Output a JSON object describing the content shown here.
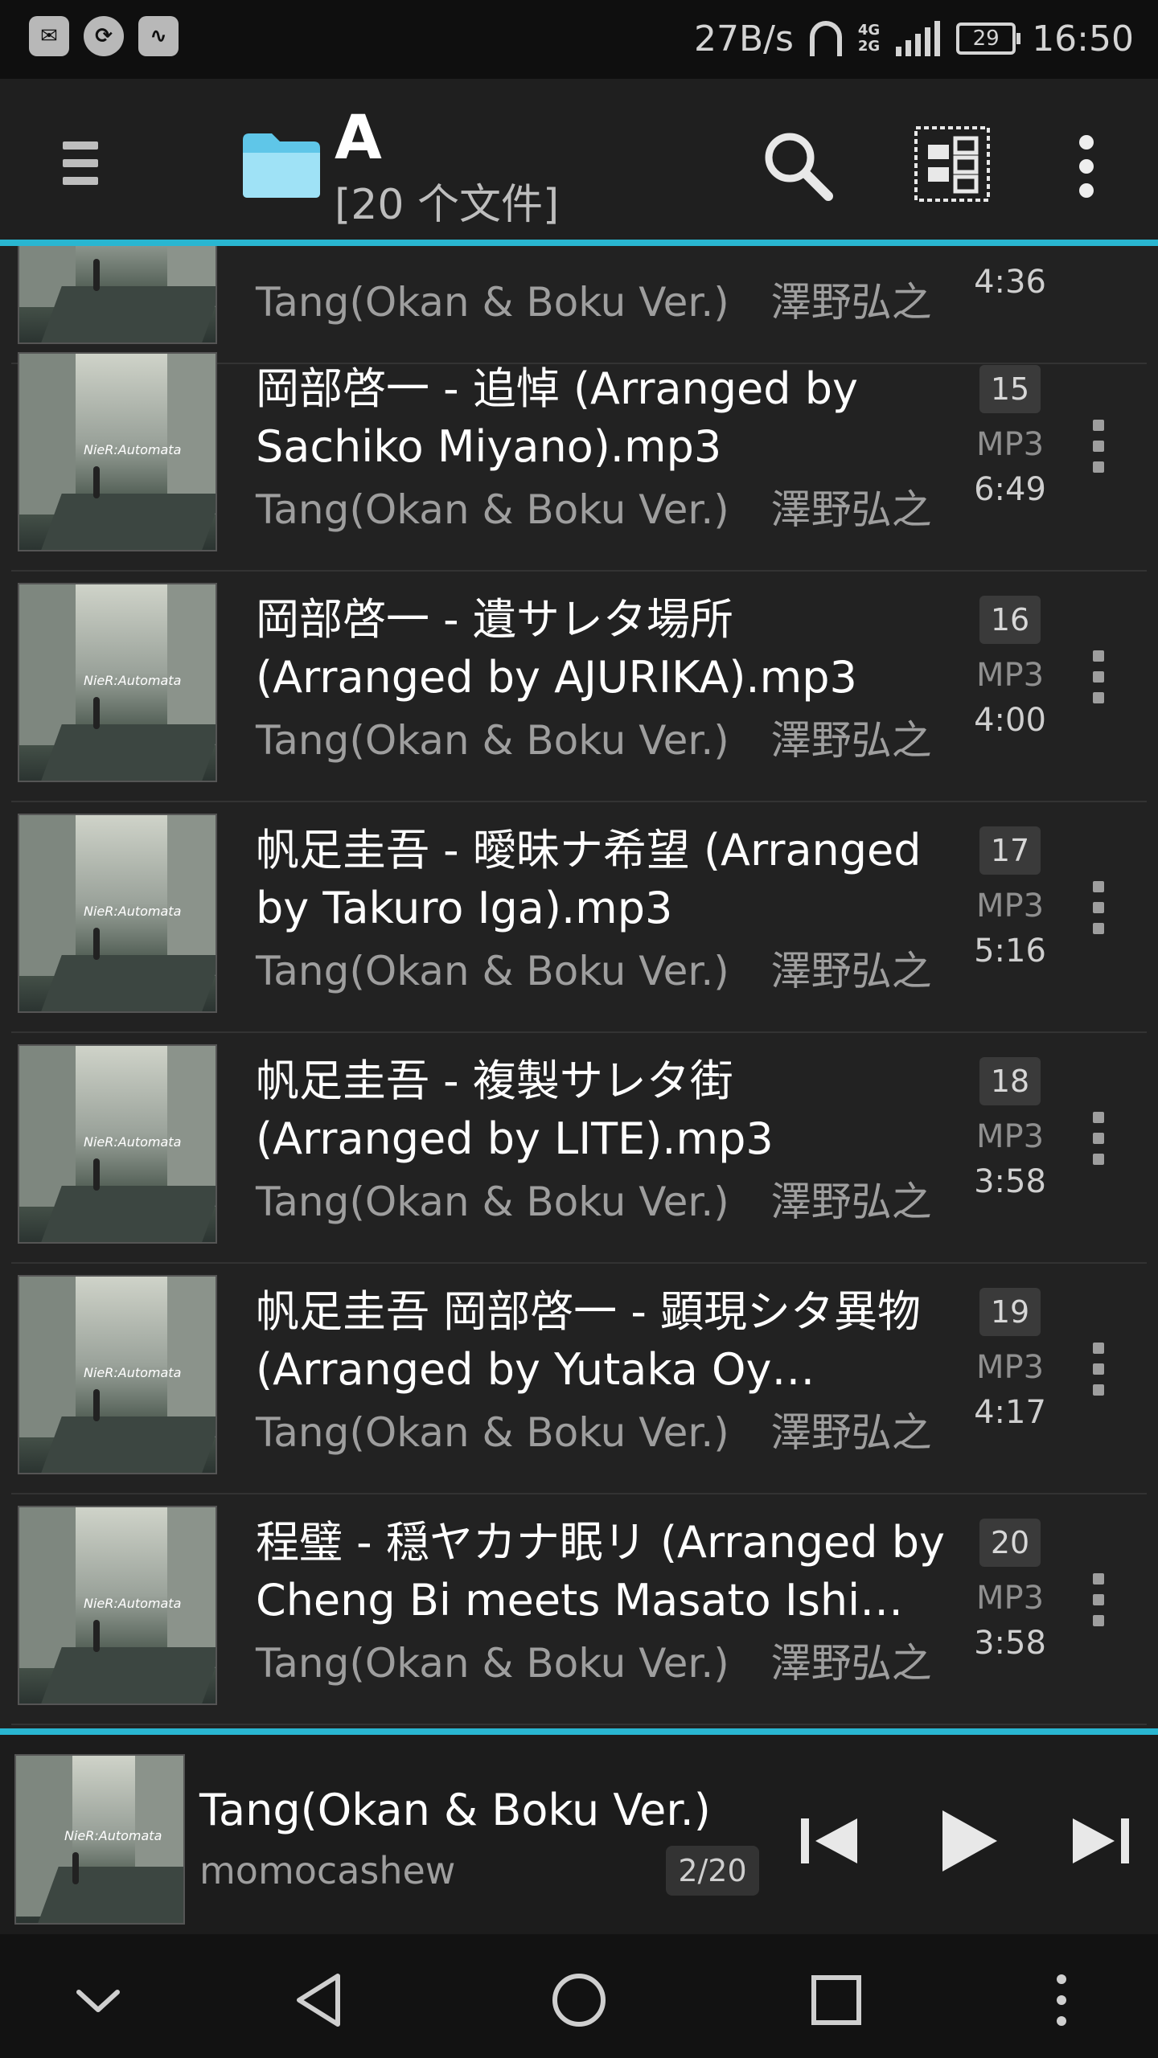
{
  "status_bar": {
    "net_speed": "27B/s",
    "network_type_top": "4G",
    "network_type_bottom": "2G",
    "battery": "29",
    "time": "16:50"
  },
  "toolbar": {
    "title": "A",
    "subtitle": "[20 个文件]",
    "accent_color": "#29b6d1"
  },
  "list": {
    "items": [
      {
        "title": "",
        "album": "Tang(Okan & Boku Ver.)",
        "artist": "澤野弘之",
        "number": "",
        "format": "",
        "duration": "4:36"
      },
      {
        "title": "岡部啓一 - 追悼 (Arranged by Sachiko Miyano).mp3",
        "album": "Tang(Okan & Boku Ver.)",
        "artist": "澤野弘之",
        "number": "15",
        "format": "MP3",
        "duration": "6:49"
      },
      {
        "title": "岡部啓一 - 遺サレタ場所 (Arranged by AJURIKA).mp3",
        "album": "Tang(Okan & Boku Ver.)",
        "artist": "澤野弘之",
        "number": "16",
        "format": "MP3",
        "duration": "4:00"
      },
      {
        "title": "帆足圭吾 - 曖昧ナ希望 (Arranged by Takuro Iga).mp3",
        "album": "Tang(Okan & Boku Ver.)",
        "artist": "澤野弘之",
        "number": "17",
        "format": "MP3",
        "duration": "5:16"
      },
      {
        "title": "帆足圭吾 - 複製サレタ街 (Arranged by LITE).mp3",
        "album": "Tang(Okan & Boku Ver.)",
        "artist": "澤野弘之",
        "number": "18",
        "format": "MP3",
        "duration": "3:58"
      },
      {
        "title": "帆足圭吾 岡部啓一 - 顕現シタ異物 (Arranged by Yutaka Oy…",
        "album": "Tang(Okan & Boku Ver.)",
        "artist": "澤野弘之",
        "number": "19",
        "format": "MP3",
        "duration": "4:17"
      },
      {
        "title": "程璧 - 穏ヤカナ眠リ (Arranged by Cheng Bi meets Masato Ishi…",
        "album": "Tang(Okan & Boku Ver.)",
        "artist": "澤野弘之",
        "number": "20",
        "format": "MP3",
        "duration": "3:58"
      }
    ]
  },
  "now_playing": {
    "title": "Tang(Okan & Boku Ver.)",
    "artist": "momocashew",
    "position": "2/20"
  },
  "album_art_text": "NieR:Automata"
}
